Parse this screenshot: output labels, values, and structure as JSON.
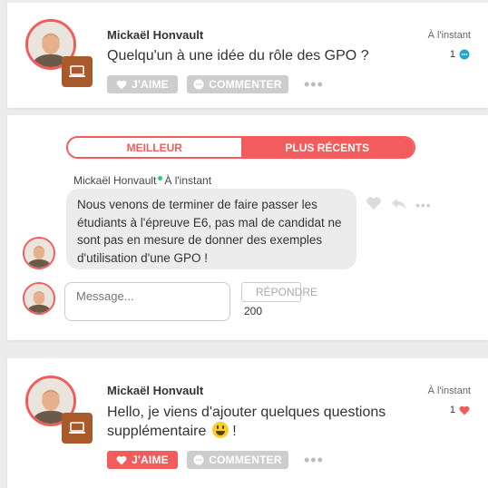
{
  "post1": {
    "author": "Mickaël Honvault",
    "text": "Quelqu'un à une idée du rôle des GPO ?",
    "timestamp": "À l'instant",
    "count": "1",
    "count_icon": "comment-bubble-icon",
    "like_label": "J'AIME",
    "comment_label": "COMMENTER",
    "more_label": "•••"
  },
  "comments": {
    "tab_best": "MEILLEUR",
    "tab_recent": "PLUS RÉCENTS",
    "active_tab": "PLUS RÉCENTS",
    "items": [
      {
        "author": "Mickaël Honvault",
        "timestamp": "À l'instant",
        "text": "Nous venons de terminer de faire passer les étudiants à l'épreuve E6, pas mal de candidat ne sont pas en mesure de donner des exemples d'utilisation d'une GPO !",
        "more_label": "•••"
      }
    ],
    "composer": {
      "placeholder": "Message...",
      "reply_label": "RÉPONDRE",
      "char_count": "200"
    }
  },
  "post2": {
    "author": "Mickaël Honvault",
    "text": "Hello, je viens d'ajouter quelques questions supplémentaire",
    "emoji": "😃",
    "text_suffix": " !",
    "timestamp": "À l'instant",
    "count": "1",
    "count_icon": "heart-icon",
    "like_label": "J'AIME",
    "comment_label": "COMMENTER",
    "more_label": "•••",
    "liked": true
  },
  "colors": {
    "accent": "#f25c5c",
    "badge": "#a85a2a",
    "comment_icon": "#1fa7c9",
    "button_grey": "#cdcdcd"
  }
}
